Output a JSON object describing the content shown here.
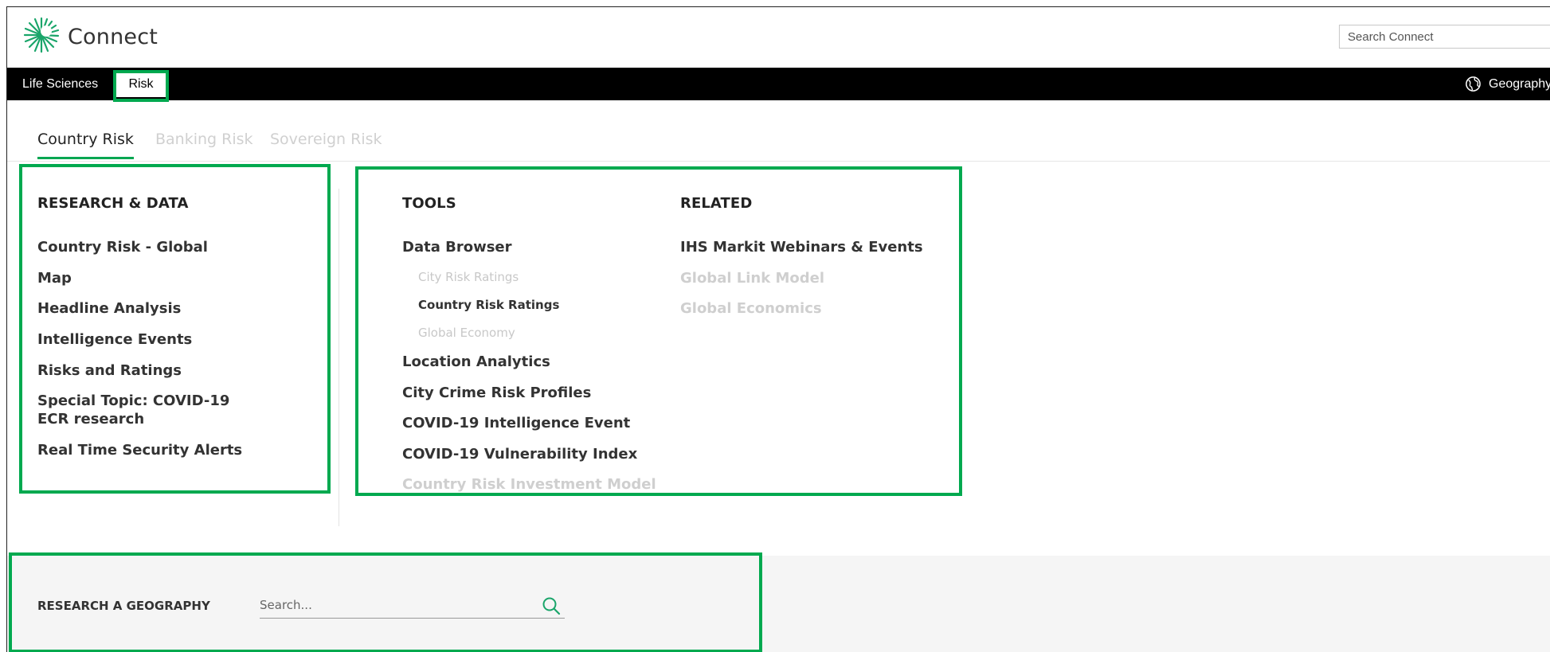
{
  "header": {
    "app_title": "Connect",
    "search_placeholder": "Search Connect"
  },
  "navbar": {
    "items": [
      {
        "label": "Life Sciences"
      },
      {
        "label": "Risk",
        "active": true
      }
    ],
    "geography_label": "Geography"
  },
  "subtabs": [
    {
      "label": "Country Risk",
      "active": true
    },
    {
      "label": "Banking Risk",
      "active": false
    },
    {
      "label": "Sovereign Risk",
      "active": false
    }
  ],
  "research_data": {
    "heading": "RESEARCH & DATA",
    "links": [
      "Country Risk - Global",
      "Map",
      "Headline Analysis",
      "Intelligence Events",
      "Risks and Ratings",
      "Special Topic: COVID-19 ECR research",
      "Real Time Security Alerts"
    ]
  },
  "tools": {
    "heading": "TOOLS",
    "data_browser": "Data Browser",
    "data_browser_subs": [
      {
        "label": "City Risk Ratings",
        "enabled": false
      },
      {
        "label": "Country Risk Ratings",
        "enabled": true
      },
      {
        "label": "Global Economy",
        "enabled": false
      }
    ],
    "links": [
      {
        "label": "Location Analytics",
        "enabled": true
      },
      {
        "label": "City Crime Risk Profiles",
        "enabled": true
      },
      {
        "label": "COVID-19 Intelligence Event",
        "enabled": true
      },
      {
        "label": "COVID-19 Vulnerability Index",
        "enabled": true
      },
      {
        "label": "Country Risk Investment Model",
        "enabled": false
      }
    ]
  },
  "related": {
    "heading": "RELATED",
    "links": [
      {
        "label": "IHS Markit Webinars & Events",
        "enabled": true
      },
      {
        "label": "Global Link Model",
        "enabled": false
      },
      {
        "label": "Global Economics",
        "enabled": false
      }
    ]
  },
  "geography_panel": {
    "label": "RESEARCH A GEOGRAPHY",
    "search_placeholder": "Search..."
  },
  "colors": {
    "accent_green": "#00a94f",
    "navbar_bg": "#000000",
    "disabled_text": "#cfcfcf"
  }
}
